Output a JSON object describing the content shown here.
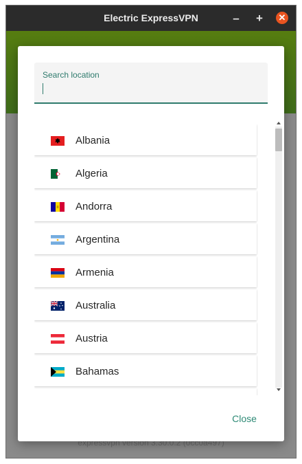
{
  "window": {
    "title": "Electric ExpressVPN",
    "minimize_glyph": "–",
    "maximize_glyph": "+",
    "close_glyph": "✕"
  },
  "footer": {
    "version_text": "expressvpn version 3.30.0.2 (0cc0a497)"
  },
  "dialog": {
    "search": {
      "label": "Search location",
      "value": ""
    },
    "locations": [
      {
        "label": "Albania",
        "flag": "albania-flag-icon"
      },
      {
        "label": "Algeria",
        "flag": "algeria-flag-icon"
      },
      {
        "label": "Andorra",
        "flag": "andorra-flag-icon"
      },
      {
        "label": "Argentina",
        "flag": "argentina-flag-icon"
      },
      {
        "label": "Armenia",
        "flag": "armenia-flag-icon"
      },
      {
        "label": "Australia",
        "flag": "australia-flag-icon"
      },
      {
        "label": "Austria",
        "flag": "austria-flag-icon"
      },
      {
        "label": "Bahamas",
        "flag": "bahamas-flag-icon"
      }
    ],
    "close_label": "Close"
  },
  "colors": {
    "accent": "#2e7a6c",
    "titlebar": "#2b2b2b",
    "close_button": "#e95420",
    "header_green": "#567d10"
  }
}
